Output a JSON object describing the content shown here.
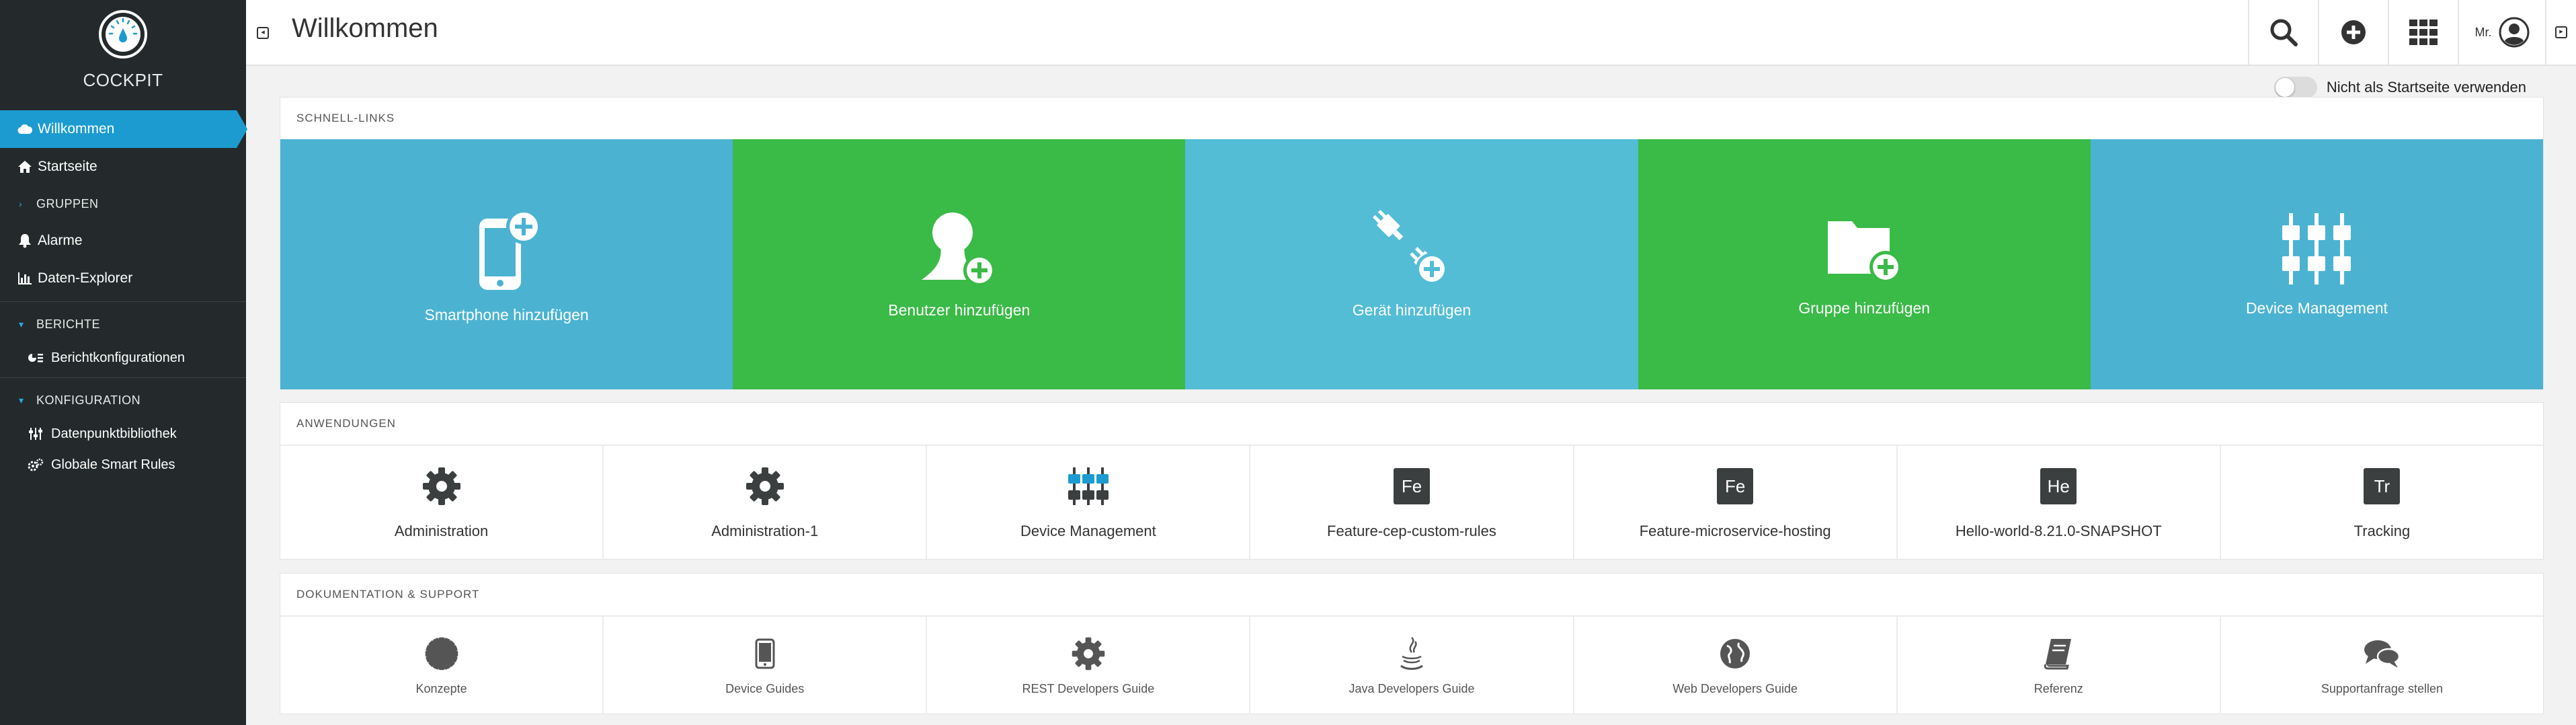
{
  "brand": {
    "name": "COCKPIT"
  },
  "sidebar": {
    "items": [
      {
        "label": "Willkommen"
      },
      {
        "label": "Startseite"
      }
    ],
    "groups_label": "GRUPPEN",
    "alarms_label": "Alarme",
    "explorer_label": "Daten-Explorer",
    "reports": {
      "label": "BERICHTE",
      "sub": "Berichtkonfigurationen"
    },
    "config": {
      "label": "KONFIGURATION",
      "sub1": "Datenpunktbibliothek",
      "sub2": "Globale Smart Rules"
    }
  },
  "header": {
    "title": "Willkommen",
    "user": "Mr."
  },
  "home_toggle": {
    "label": "Nicht als Startseite verwenden"
  },
  "quick_links": {
    "title": "SCHNELL-LINKS",
    "tiles": [
      {
        "label": "Smartphone hinzufügen",
        "icon": "smartphone-add-icon"
      },
      {
        "label": "Benutzer hinzufügen",
        "icon": "user-add-icon"
      },
      {
        "label": "Gerät hinzufügen",
        "icon": "plug-add-icon"
      },
      {
        "label": "Gruppe hinzufügen",
        "icon": "folder-add-icon"
      },
      {
        "label": "Device Management",
        "icon": "device-management-icon"
      }
    ]
  },
  "applications": {
    "title": "ANWENDUNGEN",
    "items": [
      {
        "label": "Administration",
        "icon": "gear-icon"
      },
      {
        "label": "Administration-1",
        "icon": "gear-icon"
      },
      {
        "label": "Device Management",
        "icon": "device-management-icon"
      },
      {
        "label": "Feature-cep-custom-rules",
        "badge": "Fe"
      },
      {
        "label": "Feature-microservice-hosting",
        "badge": "Fe"
      },
      {
        "label": "Hello-world-8.21.0-SNAPSHOT",
        "badge": "He"
      },
      {
        "label": "Tracking",
        "badge": "Tr"
      }
    ]
  },
  "docs": {
    "title": "DOKUMENTATION & SUPPORT",
    "items": [
      {
        "label": "Konzepte",
        "icon": "cog-icon"
      },
      {
        "label": "Device Guides",
        "icon": "phone-icon"
      },
      {
        "label": "REST Developers Guide",
        "icon": "gear-icon"
      },
      {
        "label": "Java Developers Guide",
        "icon": "java-icon"
      },
      {
        "label": "Web Developers Guide",
        "icon": "globe-icon"
      },
      {
        "label": "Referenz",
        "icon": "book-icon"
      },
      {
        "label": "Supportanfrage stellen",
        "icon": "chat-icon"
      }
    ]
  },
  "colors": {
    "accent": "#1c9bd0",
    "tile_blue": "#4bb3d1",
    "tile_green": "#3aba47",
    "sidebar": "#242a2b"
  }
}
